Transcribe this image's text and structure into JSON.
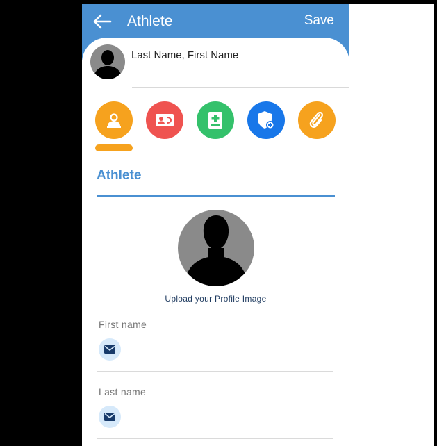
{
  "header": {
    "title": "Athlete",
    "save_label": "Save"
  },
  "profile": {
    "name": "Last Name, First Name"
  },
  "tabs": [
    {
      "name": "athlete",
      "icon": "person-icon",
      "color": "#f6a21e",
      "active": true
    },
    {
      "name": "contact",
      "icon": "contact-card-icon",
      "color": "#ef5350"
    },
    {
      "name": "medical",
      "icon": "medical-icon",
      "color": "#34c16b"
    },
    {
      "name": "insurance",
      "icon": "shield-plus-icon",
      "color": "#1877e9"
    },
    {
      "name": "attachments",
      "icon": "paperclip-icon",
      "color": "#f6a21e"
    }
  ],
  "section": {
    "title": "Athlete"
  },
  "upload": {
    "label": "Upload your Profile Image"
  },
  "fields": [
    {
      "label": "First name",
      "icon": "mail-icon"
    },
    {
      "label": "Last name",
      "icon": "mail-icon"
    }
  ],
  "colors": {
    "primary": "#4a90d2",
    "accent": "#f6a21e",
    "field_icon_bg": "#d6e9fa"
  }
}
